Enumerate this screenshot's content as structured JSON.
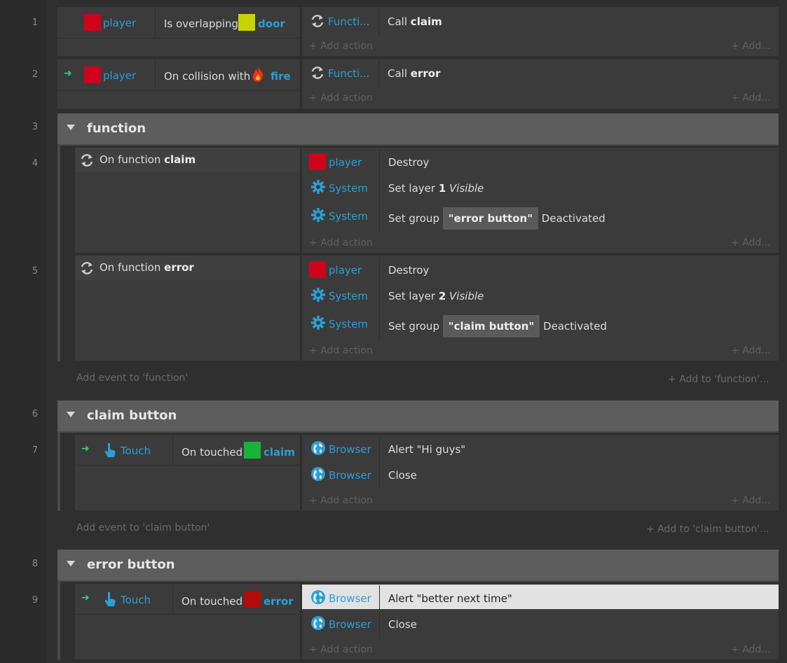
{
  "line_numbers": [
    "1",
    "2",
    "3",
    "4",
    "5",
    "6",
    "7",
    "8",
    "9"
  ],
  "colors": {
    "player": "#d0021b",
    "door": "#c8d400",
    "claim": "#19b33a",
    "error": "#b40a0a",
    "accent": "#2a9fd6",
    "arrow": "#33d17a"
  },
  "e1": {
    "object": "player",
    "condition": "Is overlapping",
    "target": "door",
    "action_object": "Functi...",
    "action_verb": "Call",
    "action_arg": "claim",
    "add_action": "Add action",
    "add_more": "Add..."
  },
  "e2": {
    "object": "player",
    "condition": "On collision with",
    "target": "fire",
    "action_object": "Functi...",
    "action_verb": "Call",
    "action_arg": "error",
    "add_action": "Add action",
    "add_more": "Add..."
  },
  "g1": {
    "title": "function",
    "add_event": "Add event to 'function'",
    "add_to": "Add to 'function'..."
  },
  "e4": {
    "trigger": "On function",
    "name": "claim",
    "actions": [
      {
        "obj": "player",
        "text": "Destroy"
      },
      {
        "obj": "System",
        "pre": "Set layer",
        "num": "1",
        "post": "Visible"
      },
      {
        "obj": "System",
        "pre": "Set group",
        "chip": "\"error button\"",
        "post": "Deactivated"
      }
    ],
    "add_action": "Add action",
    "add_more": "Add..."
  },
  "e5": {
    "trigger": "On function",
    "name": "error",
    "actions": [
      {
        "obj": "player",
        "text": "Destroy"
      },
      {
        "obj": "System",
        "pre": "Set layer",
        "num": "2",
        "post": "Visible"
      },
      {
        "obj": "System",
        "pre": "Set group",
        "chip": "\"claim button\"",
        "post": "Deactivated"
      }
    ],
    "add_action": "Add action",
    "add_more": "Add..."
  },
  "g2": {
    "title": "claim button",
    "add_event": "Add event to 'claim button'",
    "add_to": "Add to 'claim button'..."
  },
  "e7": {
    "object": "Touch",
    "condition": "On touched",
    "target": "claim",
    "actions": [
      {
        "obj": "Browser",
        "text": "Alert \"Hi guys\""
      },
      {
        "obj": "Browser",
        "text": "Close"
      }
    ],
    "add_action": "Add action",
    "add_more": "Add..."
  },
  "g3": {
    "title": "error button"
  },
  "e9": {
    "object": "Touch",
    "condition": "On touched",
    "target": "error",
    "actions": [
      {
        "obj": "Browser",
        "text": "Alert \"better next time\""
      },
      {
        "obj": "Browser",
        "text": "Close"
      }
    ],
    "add_action": "Add action",
    "add_more": "Add..."
  }
}
